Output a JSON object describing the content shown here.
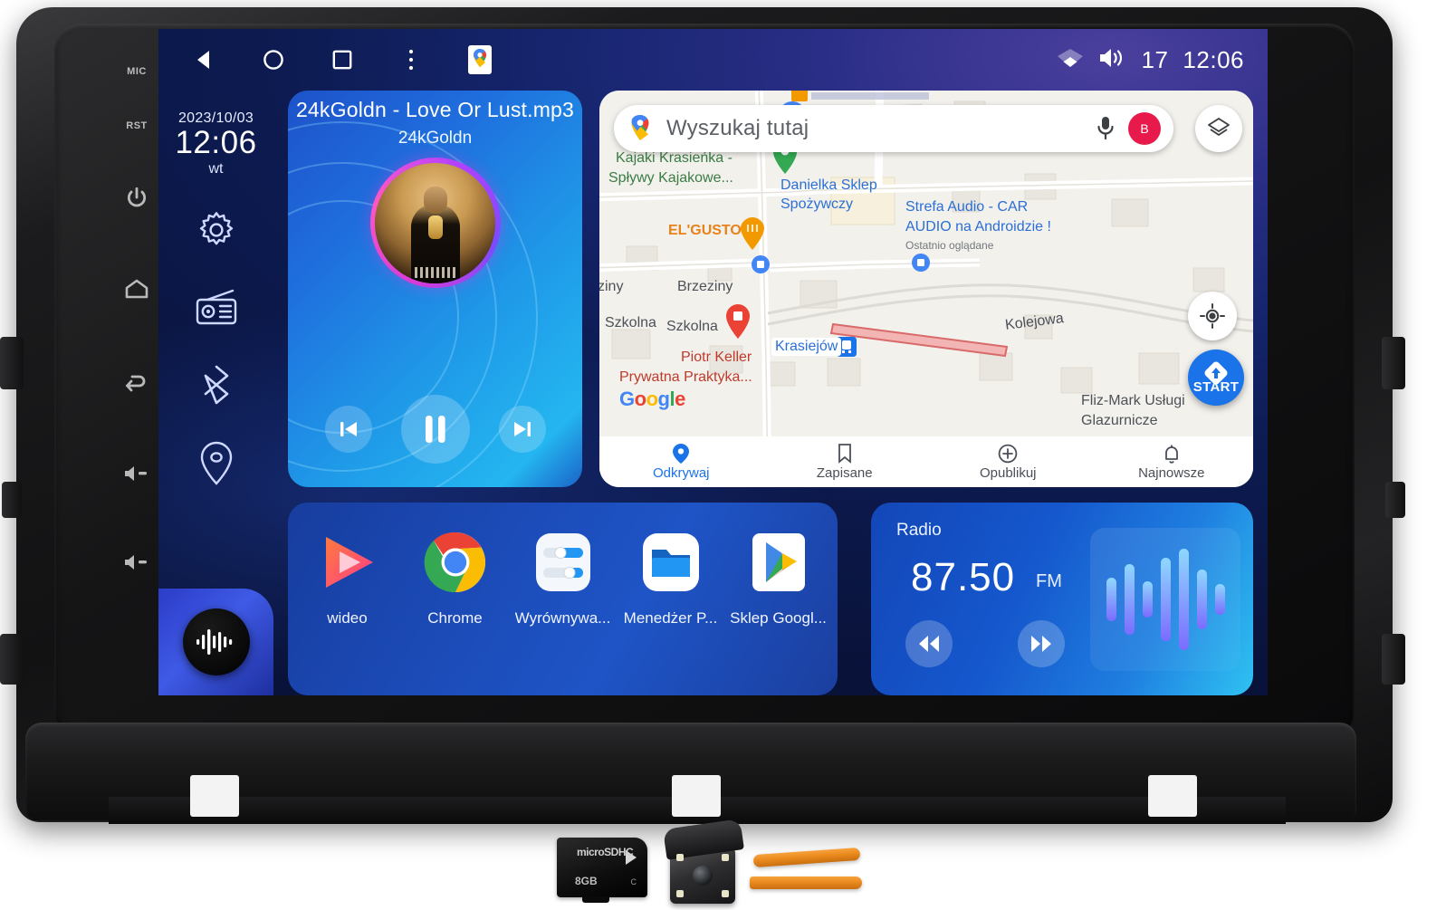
{
  "device": {
    "hardware_buttons": [
      {
        "name": "mic",
        "label": "MIC"
      },
      {
        "name": "reset",
        "label": "RST"
      },
      {
        "name": "power",
        "label": ""
      },
      {
        "name": "home",
        "label": ""
      },
      {
        "name": "back",
        "label": ""
      },
      {
        "name": "volume-up",
        "label": ""
      },
      {
        "name": "volume-down",
        "label": ""
      }
    ]
  },
  "statusbar": {
    "nav": [
      {
        "name": "back-icon",
        "label": "back"
      },
      {
        "name": "home-icon",
        "label": "home"
      },
      {
        "name": "recents-icon",
        "label": "recents"
      },
      {
        "name": "overflow-menu-icon",
        "label": "more"
      },
      {
        "name": "google-maps-icon",
        "label": "Maps"
      }
    ],
    "wifi_icon": "wifi-icon",
    "volume_icon": "volume-icon",
    "volume_level": "17",
    "clock": "12:06"
  },
  "dock": {
    "date": "2023/10/03",
    "time": "12:06",
    "weekday": "wt",
    "items": [
      {
        "name": "settings-icon",
        "label": "Ustawienia"
      },
      {
        "name": "radio-icon",
        "label": "Radio"
      },
      {
        "name": "bluetooth-icon",
        "label": "Bluetooth"
      },
      {
        "name": "location-icon",
        "label": "Nawigacja"
      }
    ],
    "voice_button": "voice-assistant-icon"
  },
  "music": {
    "title": "24kGoldn - Love Or Lust.mp3",
    "artist": "24kGoldn",
    "controls": {
      "previous": "previous-track",
      "pause": "pause",
      "next": "next-track"
    },
    "state": "playing"
  },
  "map": {
    "search_placeholder": "Wyszukaj tutaj",
    "mic_icon": "microphone-icon",
    "avatar_initial": "B",
    "layers_icon": "layers-icon",
    "locate_icon": "my-location-icon",
    "start_label": "START",
    "attribution": "Google",
    "labels": [
      {
        "text": "Kajaki Krasieńka -",
        "color": "green"
      },
      {
        "text": "Spływy Kajakowe...",
        "color": "green"
      },
      {
        "text": "Danielka Sklep",
        "color": "blue"
      },
      {
        "text": "Spożywczy",
        "color": "blue"
      },
      {
        "text": "EL'GUSTO",
        "color": "orange"
      },
      {
        "text": "Strefa Audio - CAR",
        "color": "blue"
      },
      {
        "text": "AUDIO na Androidzie !",
        "color": "blue"
      },
      {
        "text": "Ostatnio oglądane",
        "color": "small"
      },
      {
        "text": "Brzeziny",
        "color": "grey"
      },
      {
        "text": "ziny",
        "color": "grey"
      },
      {
        "text": "Szkolna",
        "color": "grey"
      },
      {
        "text": "Szkolna",
        "color": "grey"
      },
      {
        "text": "Kolejowa",
        "color": "grey"
      },
      {
        "text": "Krasiejów",
        "color": "blue"
      },
      {
        "text": "Piotr Keller",
        "color": "red"
      },
      {
        "text": "Prywatna Praktyka...",
        "color": "red"
      },
      {
        "text": "Fliz-Mark Usługi",
        "color": "grey"
      },
      {
        "text": "Glazurnicze",
        "color": "grey"
      }
    ],
    "bottom_nav": [
      {
        "name": "explore",
        "label": "Odkrywaj",
        "icon": "pin-icon",
        "active": true
      },
      {
        "name": "saved",
        "label": "Zapisane",
        "icon": "bookmark-icon",
        "active": false
      },
      {
        "name": "contribute",
        "label": "Opublikuj",
        "icon": "plus-circle-icon",
        "active": false
      },
      {
        "name": "updates",
        "label": "Najnowsze",
        "icon": "bell-icon",
        "active": false
      }
    ]
  },
  "apps": [
    {
      "name": "wideo",
      "label": "wideo",
      "icon": "video-player-icon"
    },
    {
      "name": "chrome",
      "label": "Chrome",
      "icon": "chrome-icon"
    },
    {
      "name": "equalizer",
      "label": "Wyrównywa...",
      "icon": "equalizer-icon"
    },
    {
      "name": "file-manager",
      "label": "Menedżer P...",
      "icon": "folder-icon"
    },
    {
      "name": "play-store",
      "label": "Sklep Googl...",
      "icon": "play-store-icon"
    }
  ],
  "radio": {
    "title": "Radio",
    "frequency": "87.50",
    "band": "FM",
    "prev_icon": "rewind-icon",
    "next_icon": "fast-forward-icon",
    "equalizer_icon": "equalizer-visual"
  },
  "accessories": [
    {
      "name": "microsd-card",
      "label": "8GB",
      "brand": "microSDHC",
      "class": "C"
    },
    {
      "name": "rear-camera",
      "label": ""
    },
    {
      "name": "pry-tools",
      "label": ""
    }
  ],
  "colors": {
    "accent_blue": "#1a73e8",
    "screen_purple": "#4b3f9e",
    "card_blue": "#1f6ddd",
    "avatar_pink": "#e8194b",
    "orange_tool": "#ea8a1e"
  }
}
